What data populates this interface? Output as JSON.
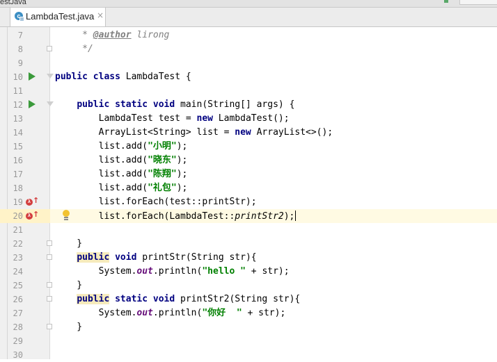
{
  "window": {
    "previous_tab_fragment": "estJava"
  },
  "editor_tab": {
    "title": "LambdaTest.java",
    "icon": "java-class-icon",
    "close_glyph": "×"
  },
  "lines": [
    {
      "n": "7",
      "parts": [
        {
          "t": "     * ",
          "c": "doc"
        },
        {
          "t": "@author",
          "c": "tag"
        },
        {
          "t": " lirong",
          "c": "doc"
        }
      ]
    },
    {
      "n": "8",
      "parts": [
        {
          "t": "     */",
          "c": "doc"
        }
      ]
    },
    {
      "n": "9",
      "parts": []
    },
    {
      "n": "10",
      "parts": [
        {
          "t": "public class",
          "c": "kw"
        },
        {
          "t": " LambdaTest {",
          "c": ""
        }
      ]
    },
    {
      "n": "11",
      "parts": []
    },
    {
      "n": "12",
      "parts": [
        {
          "t": "    ",
          "c": ""
        },
        {
          "t": "public static void",
          "c": "kw"
        },
        {
          "t": " main(String[] args) {",
          "c": ""
        }
      ]
    },
    {
      "n": "13",
      "parts": [
        {
          "t": "        LambdaTest test = ",
          "c": ""
        },
        {
          "t": "new",
          "c": "kw"
        },
        {
          "t": " LambdaTest();",
          "c": ""
        }
      ]
    },
    {
      "n": "14",
      "parts": [
        {
          "t": "        ArrayList<String> list = ",
          "c": ""
        },
        {
          "t": "new",
          "c": "kw"
        },
        {
          "t": " ArrayList<>();",
          "c": ""
        }
      ]
    },
    {
      "n": "15",
      "parts": [
        {
          "t": "        list.add(",
          "c": ""
        },
        {
          "t": "\"小明\"",
          "c": "str"
        },
        {
          "t": ");",
          "c": ""
        }
      ]
    },
    {
      "n": "16",
      "parts": [
        {
          "t": "        list.add(",
          "c": ""
        },
        {
          "t": "\"晓东\"",
          "c": "str"
        },
        {
          "t": ");",
          "c": ""
        }
      ]
    },
    {
      "n": "17",
      "parts": [
        {
          "t": "        list.add(",
          "c": ""
        },
        {
          "t": "\"陈翔\"",
          "c": "str"
        },
        {
          "t": ");",
          "c": ""
        }
      ]
    },
    {
      "n": "18",
      "parts": [
        {
          "t": "        list.add(",
          "c": ""
        },
        {
          "t": "\"礼包\"",
          "c": "str"
        },
        {
          "t": ");",
          "c": ""
        }
      ]
    },
    {
      "n": "19",
      "parts": [
        {
          "t": "        list.forEach(test::printStr);",
          "c": ""
        }
      ]
    },
    {
      "n": "20",
      "parts": [
        {
          "t": "        list.forEach(LambdaTest::",
          "c": ""
        },
        {
          "t": "printStr2",
          "c": "mref"
        },
        {
          "t": ");",
          "c": ""
        }
      ]
    },
    {
      "n": "21",
      "parts": []
    },
    {
      "n": "22",
      "parts": [
        {
          "t": "    }",
          "c": ""
        }
      ]
    },
    {
      "n": "23",
      "parts": [
        {
          "t": "    ",
          "c": ""
        },
        {
          "t": "public",
          "c": "kw kwhl"
        },
        {
          "t": " ",
          "c": ""
        },
        {
          "t": "void",
          "c": "kw"
        },
        {
          "t": " printStr(String str){",
          "c": ""
        }
      ]
    },
    {
      "n": "24",
      "parts": [
        {
          "t": "        System.",
          "c": ""
        },
        {
          "t": "out",
          "c": "fld"
        },
        {
          "t": ".println(",
          "c": ""
        },
        {
          "t": "\"hello \"",
          "c": "str"
        },
        {
          "t": " + str);",
          "c": ""
        }
      ]
    },
    {
      "n": "25",
      "parts": [
        {
          "t": "    }",
          "c": ""
        }
      ]
    },
    {
      "n": "26",
      "parts": [
        {
          "t": "    ",
          "c": ""
        },
        {
          "t": "public",
          "c": "kw kwhl"
        },
        {
          "t": " ",
          "c": ""
        },
        {
          "t": "static void",
          "c": "kw"
        },
        {
          "t": " printStr2(String str){",
          "c": ""
        }
      ]
    },
    {
      "n": "27",
      "parts": [
        {
          "t": "        System.",
          "c": ""
        },
        {
          "t": "out",
          "c": "fld"
        },
        {
          "t": ".println(",
          "c": ""
        },
        {
          "t": "\"你好  \"",
          "c": "str"
        },
        {
          "t": " + str);",
          "c": ""
        }
      ]
    },
    {
      "n": "28",
      "parts": [
        {
          "t": "    }",
          "c": ""
        }
      ]
    },
    {
      "n": "29",
      "parts": []
    },
    {
      "n": "30",
      "parts": []
    }
  ],
  "gutter_markers": {
    "run_icon_lines": [
      "10",
      "12"
    ],
    "override_icon_lines": [
      "19",
      "20"
    ],
    "intention_bulb_line": "20",
    "fold_box_lines": [
      "8",
      "22",
      "23",
      "25",
      "26",
      "28"
    ],
    "fold_start_lines": [
      "10",
      "12"
    ],
    "caret_line": "20"
  }
}
